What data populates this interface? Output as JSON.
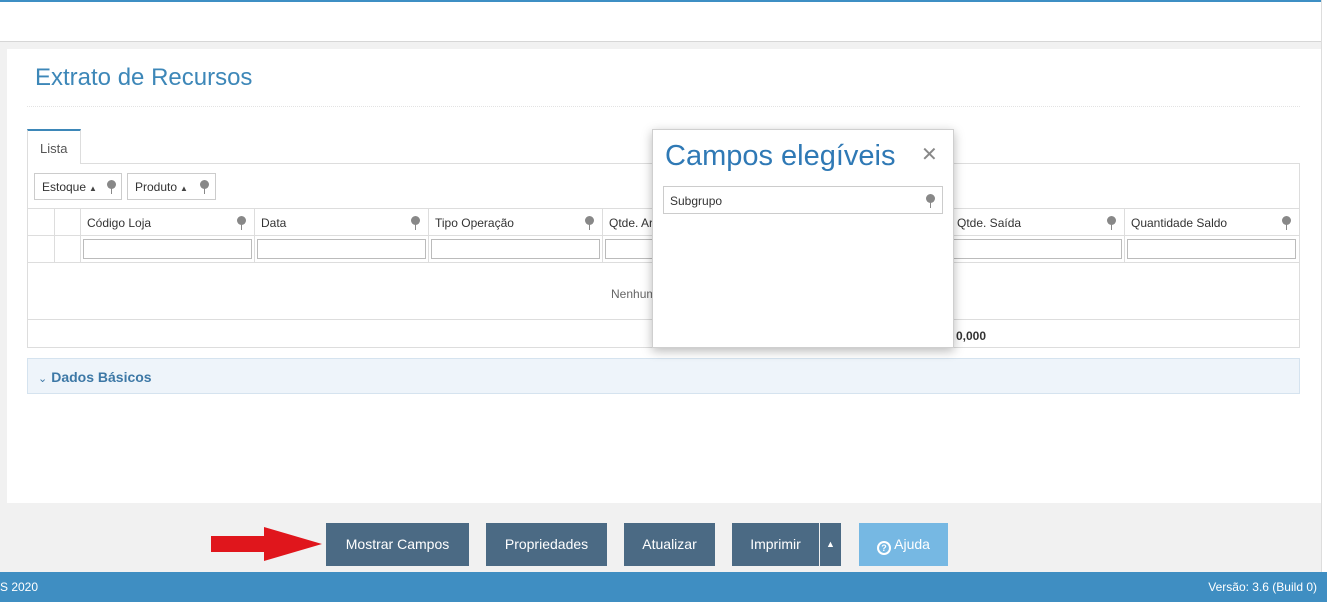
{
  "page": {
    "title": "Extrato de Recursos",
    "tab_label": "Lista"
  },
  "grid": {
    "group_chips": [
      {
        "label": "Estoque",
        "sort": "▲"
      },
      {
        "label": "Produto",
        "sort": "▲"
      }
    ],
    "columns": [
      {
        "label": "Código Loja"
      },
      {
        "label": "Data"
      },
      {
        "label": "Tipo Operação"
      },
      {
        "label": "Qtde. Ar"
      },
      {
        "label": "Qtde. Saída"
      },
      {
        "label": "Quantidade Saldo"
      }
    ],
    "no_data_text": "Nenhum",
    "total_value": "0,000"
  },
  "accordion": {
    "label": "Dados Básicos",
    "chevron": "⌄"
  },
  "popup": {
    "title": "Campos elegíveis",
    "close_glyph": "✕",
    "fields": [
      "Subgrupo"
    ]
  },
  "toolbar": {
    "mostrar_campos": "Mostrar Campos",
    "propriedades": "Propriedades",
    "atualizar": "Atualizar",
    "imprimir": "Imprimir",
    "imprimir_toggle": "▲",
    "ajuda": "Ajuda",
    "ajuda_icon": "?"
  },
  "statusbar": {
    "left": "S 2020",
    "right": "Versão: 3.6 (Build 0)"
  },
  "colors": {
    "accent": "#3d87b8",
    "toolbar_button": "#4b6a84",
    "help_button": "#76b8e3",
    "arrow": "#e0161c",
    "statusbar": "#3f8ec2"
  }
}
